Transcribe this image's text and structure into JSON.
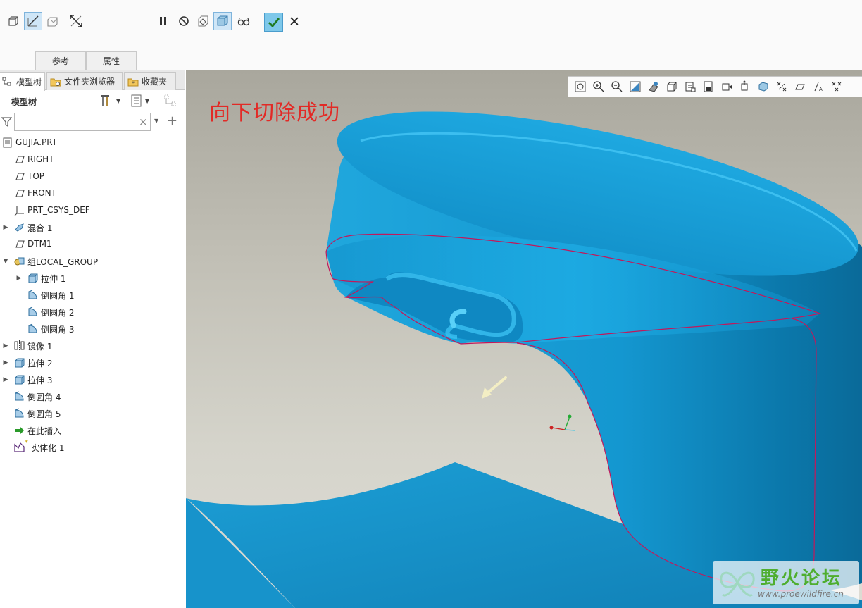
{
  "ribbon": {
    "tabs": [
      "参考",
      "属性"
    ],
    "left_tools": [
      "solid-icon",
      "surface-icon",
      "remove-material-icon",
      "flip-direction-icon"
    ],
    "mid_tools": [
      "pause-icon",
      "no-preview-icon",
      "verify-icon",
      "feature-preview-icon",
      "glasses-icon"
    ],
    "confirm_icon": "checkmark-icon",
    "cancel_label": "✕"
  },
  "panel": {
    "tabs": [
      {
        "label": "模型树",
        "icon": "model-tree-icon"
      },
      {
        "label": "文件夹浏览器",
        "icon": "folder-browser-icon"
      },
      {
        "label": "收藏夹",
        "icon": "favorites-icon"
      }
    ],
    "tree_title": "模型树",
    "filter_placeholder": "",
    "filter_clear": "×",
    "filter_add": "+"
  },
  "tree": [
    {
      "label": "GUJIA.PRT",
      "icon": "part-icon",
      "indent": 0,
      "expander": ""
    },
    {
      "label": "RIGHT",
      "icon": "datum-plane-icon",
      "indent": 1,
      "expander": ""
    },
    {
      "label": "TOP",
      "icon": "datum-plane-icon",
      "indent": 1,
      "expander": ""
    },
    {
      "label": "FRONT",
      "icon": "datum-plane-icon",
      "indent": 1,
      "expander": ""
    },
    {
      "label": "PRT_CSYS_DEF",
      "icon": "csys-icon",
      "indent": 1,
      "expander": ""
    },
    {
      "label": "混合 1",
      "icon": "blend-icon",
      "indent": 1,
      "expander": "▶"
    },
    {
      "label": "DTM1",
      "icon": "datum-plane-icon",
      "indent": 1,
      "expander": ""
    },
    {
      "label": "组LOCAL_GROUP",
      "icon": "group-icon",
      "indent": 1,
      "expander": "▼"
    },
    {
      "label": "拉伸 1",
      "icon": "extrude-icon",
      "indent": 2,
      "expander": "▶"
    },
    {
      "label": "倒圆角 1",
      "icon": "round-icon",
      "indent": 2,
      "expander": ""
    },
    {
      "label": "倒圆角 2",
      "icon": "round-icon",
      "indent": 2,
      "expander": ""
    },
    {
      "label": "倒圆角 3",
      "icon": "round-icon",
      "indent": 2,
      "expander": ""
    },
    {
      "label": "镜像 1",
      "icon": "mirror-icon",
      "indent": 1,
      "expander": "▶"
    },
    {
      "label": "拉伸 2",
      "icon": "extrude-icon",
      "indent": 1,
      "expander": "▶"
    },
    {
      "label": "拉伸 3",
      "icon": "extrude-icon",
      "indent": 1,
      "expander": "▶"
    },
    {
      "label": "倒圆角 4",
      "icon": "round-icon",
      "indent": 1,
      "expander": ""
    },
    {
      "label": "倒圆角 5",
      "icon": "round-icon",
      "indent": 1,
      "expander": ""
    },
    {
      "label": "在此插入",
      "icon": "insert-here-icon",
      "indent": 1,
      "expander": ""
    },
    {
      "label": "实体化 1",
      "icon": "solidify-icon",
      "indent": 1,
      "expander": ""
    }
  ],
  "viewport": {
    "annotation": "向下切除成功",
    "model_color": "#1aa0d8",
    "edge_color": "#c2185b",
    "toolbar_icons": [
      "refit-icon",
      "zoom-in-icon",
      "zoom-out-icon",
      "repaint-icon",
      "display-style-icon",
      "standard-orientation-icon",
      "saved-views-icon",
      "view-manager-icon",
      "perspective-icon",
      "spin-center-icon",
      "annotation-display-icon",
      "plane-display-icon",
      "axis-display-icon",
      "point-display-icon",
      "csys-display-icon"
    ],
    "watermark": {
      "title": "野火论坛",
      "url": "www.proewildfire.cn"
    }
  }
}
